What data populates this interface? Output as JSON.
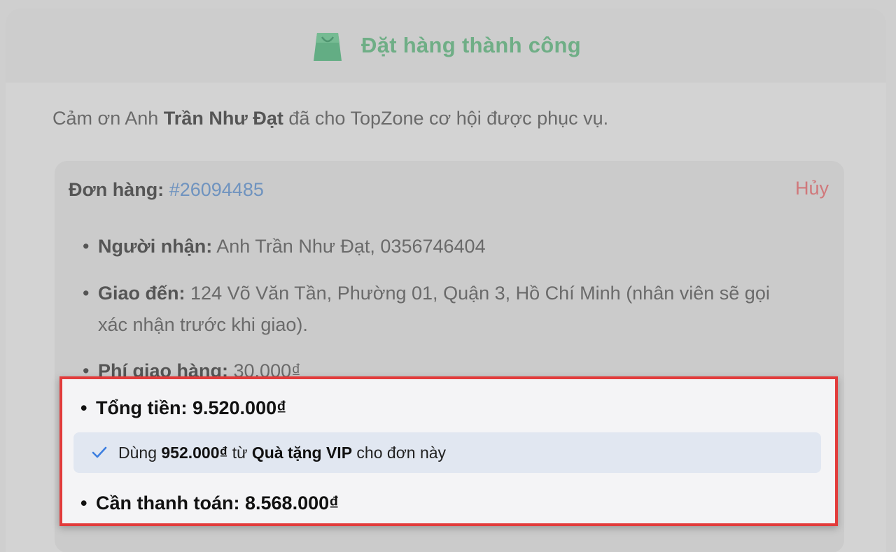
{
  "header": {
    "icon": "shopping-bag-icon",
    "title": "Đặt hàng thành công",
    "accent_color": "#6fae86"
  },
  "thanks": {
    "prefix": "Cảm ơn Anh ",
    "customer_name": "Trần Như Đạt",
    "suffix": " đã cho TopZone cơ hội được phục vụ."
  },
  "order": {
    "label": "Đơn hàng:",
    "id": "#26094485",
    "cancel_label": "Hủy",
    "cancel_color": "#d0787b",
    "recipient_label": "Người nhận:",
    "recipient_value": "Anh Trần Như Đạt, 0356746404",
    "delivery_label": "Giao đến:",
    "delivery_value": "124 Võ Văn Tần, Phường 01, Quận 3, Hồ Chí Minh (nhân viên sẽ gọi xác nhận trước khi giao).",
    "shipping_label": "Phí giao hàng:",
    "shipping_value": "30.000₫"
  },
  "summary": {
    "total_label": "Tổng tiền:",
    "total_value": "9.520.000₫",
    "vip_prefix": "Dùng ",
    "vip_amount": "952.000₫",
    "vip_middle": " từ ",
    "vip_source": "Quà tặng VIP",
    "vip_suffix": " cho đơn này",
    "vip_icon": "check-icon",
    "due_label": "Cần thanh toán:",
    "due_value": "8.568.000₫",
    "highlight_border_color": "#e23b3b"
  }
}
